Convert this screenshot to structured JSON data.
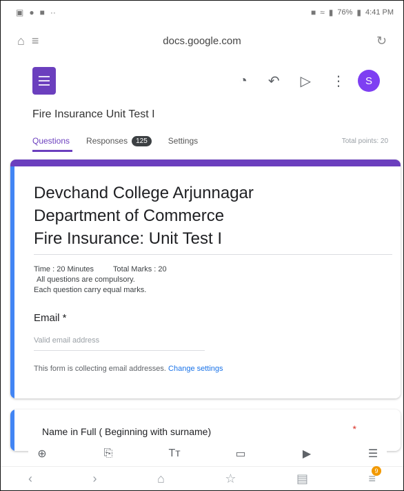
{
  "status": {
    "battery_pct": "76%",
    "time": "4:41 PM"
  },
  "browser": {
    "url": "docs.google.com"
  },
  "toolbar": {
    "avatar_letter": "S"
  },
  "form": {
    "title": "Fire Insurance Unit Test I",
    "tabs": [
      {
        "label": "Questions"
      },
      {
        "label": "Responses",
        "badge": "125"
      },
      {
        "label": "Settings"
      }
    ],
    "total_points": "Total points: 20",
    "header": {
      "lines": [
        "Devchand College Arjunnagar",
        "Department of Commerce",
        "Fire Insurance: Unit Test I"
      ],
      "time": "Time : 20 Minutes",
      "total_marks": "Total Marks : 20",
      "note1": "All questions are compulsory.",
      "note2": "Each question carry equal marks."
    },
    "email": {
      "label": "Email *",
      "placeholder": "Valid email address",
      "notice": "This form is collecting email addresses.",
      "change_link": "Change settings"
    },
    "question": {
      "title": "Name in Full ( Beginning with surname)",
      "required": "*"
    }
  },
  "colors": {
    "accent": "#6b3fbe",
    "left_bar": "#4285f4",
    "avatar": "#7e3ff2"
  },
  "nav": {
    "notification_count": "9"
  }
}
